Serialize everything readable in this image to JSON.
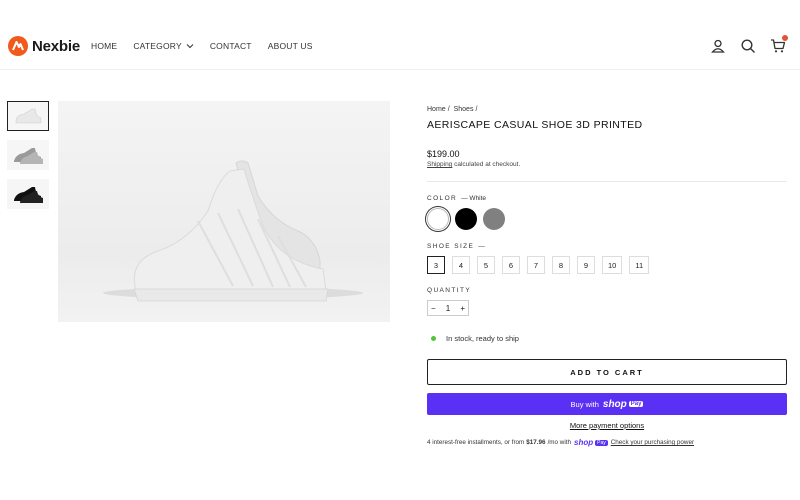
{
  "header": {
    "brand": "Nexbie",
    "nav": [
      {
        "label": "HOME"
      },
      {
        "label": "CATEGORY"
      },
      {
        "label": "CONTACT"
      },
      {
        "label": "ABOUT US"
      }
    ],
    "icons": [
      "account-icon",
      "search-icon",
      "cart-icon"
    ]
  },
  "product": {
    "breadcrumb": [
      "Home",
      "/",
      "Shoes",
      "/"
    ],
    "title": "AERISCAPE CASUAL SHOE 3D PRINTED",
    "price": "$199.00",
    "shipping_link": "Shipping",
    "shipping_rest": "calculated at checkout.",
    "color_label": "COLOR",
    "color_selected": "— White",
    "colors": [
      {
        "name": "White",
        "hex": "#ffffff"
      },
      {
        "name": "Black",
        "hex": "#000000"
      },
      {
        "name": "Gray",
        "hex": "#808080"
      }
    ],
    "size_label": "SHOE SIZE",
    "size_selected": "—",
    "sizes": [
      "3",
      "4",
      "5",
      "6",
      "7",
      "8",
      "9",
      "10",
      "11"
    ],
    "quantity_label": "QUANTITY",
    "qty_minus": "−",
    "qty_value": "1",
    "qty_plus": "+",
    "stock_text": "In stock, ready to ship",
    "add_to_cart": "ADD TO CART",
    "buy_with": "Buy with",
    "shop_word": "shop",
    "pay_word": "Pay",
    "more_payment": "More payment options",
    "installments_pre": "4 interest-free installments, or from",
    "installments_amount": "$17.96",
    "installments_mid": "/mo with",
    "installments_link": "Check your purchasing power"
  },
  "colors": {
    "brand": "#f05a1c",
    "shop_pay": "#5a31f4",
    "in_stock": "#54c43a",
    "cart_badge": "#e0523a"
  }
}
